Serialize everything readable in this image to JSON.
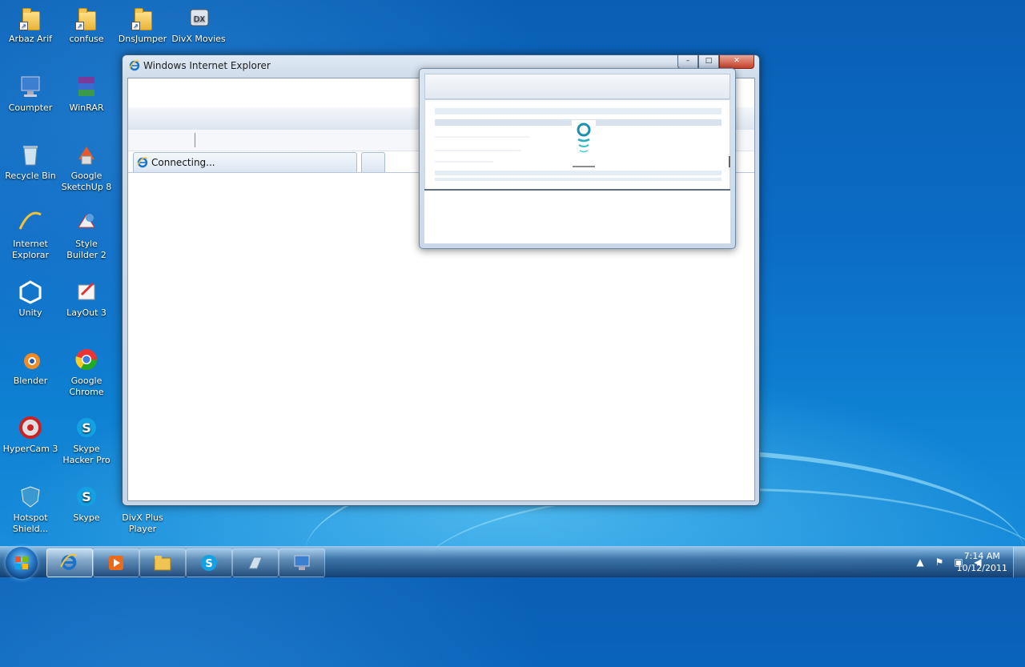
{
  "desktop": {
    "icons": [
      {
        "label": "Arbaz Arif",
        "kind": "folder-icon"
      },
      {
        "label": "confuse",
        "kind": "folder-icon"
      },
      {
        "label": "DnsJumper",
        "kind": "folder-icon"
      },
      {
        "label": "DivX Movies",
        "kind": "divx-icon"
      },
      {
        "label": "Coumpter",
        "kind": "computer-icon"
      },
      {
        "label": "WinRAR",
        "kind": "winrar-icon"
      },
      {
        "label": "Recycle Bin",
        "kind": "recycle-bin-icon"
      },
      {
        "label": "Google SketchUp 8",
        "kind": "sketchup-icon"
      },
      {
        "label": "Internet Explorar",
        "kind": "internet-explorer-icon"
      },
      {
        "label": "Style Builder 2",
        "kind": "style-builder-icon"
      },
      {
        "label": "Unity",
        "kind": "unity-icon"
      },
      {
        "label": "LayOut 3",
        "kind": "layout-icon"
      },
      {
        "label": "Blender",
        "kind": "blender-icon"
      },
      {
        "label": "Google Chrome",
        "kind": "chrome-icon"
      },
      {
        "label": "HyperCam 3",
        "kind": "hypercam-icon"
      },
      {
        "label": "Skype Hacker Pro",
        "kind": "skype-icon"
      },
      {
        "label": "Hotspot Shield...",
        "kind": "hotspot-shield-icon"
      },
      {
        "label": "Skype",
        "kind": "skype-icon"
      },
      {
        "label": "DivX Plus Player",
        "kind": "divx-player-icon"
      }
    ]
  },
  "ie_window": {
    "title": "Windows Internet Explorer",
    "tab_label": "Connecting...",
    "buttons": {
      "minimize": "–",
      "maximize": "□",
      "close": "✕"
    }
  },
  "taskbar": {
    "apps": [
      "internet-explorer-icon",
      "media-player-icon",
      "explorer-icon",
      "skype-icon",
      "app-icon",
      "connection-icon"
    ],
    "tray_icons": [
      "show-hidden-icon",
      "action-center-icon",
      "network-icon",
      "volume-icon"
    ],
    "clock_time": "7:14 AM",
    "clock_date": "10/12/2011"
  },
  "colors": {
    "desktop_blue": "#0b6bc4",
    "ie_blue": "#1a73c9",
    "ie_yellow": "#f2c23c"
  }
}
